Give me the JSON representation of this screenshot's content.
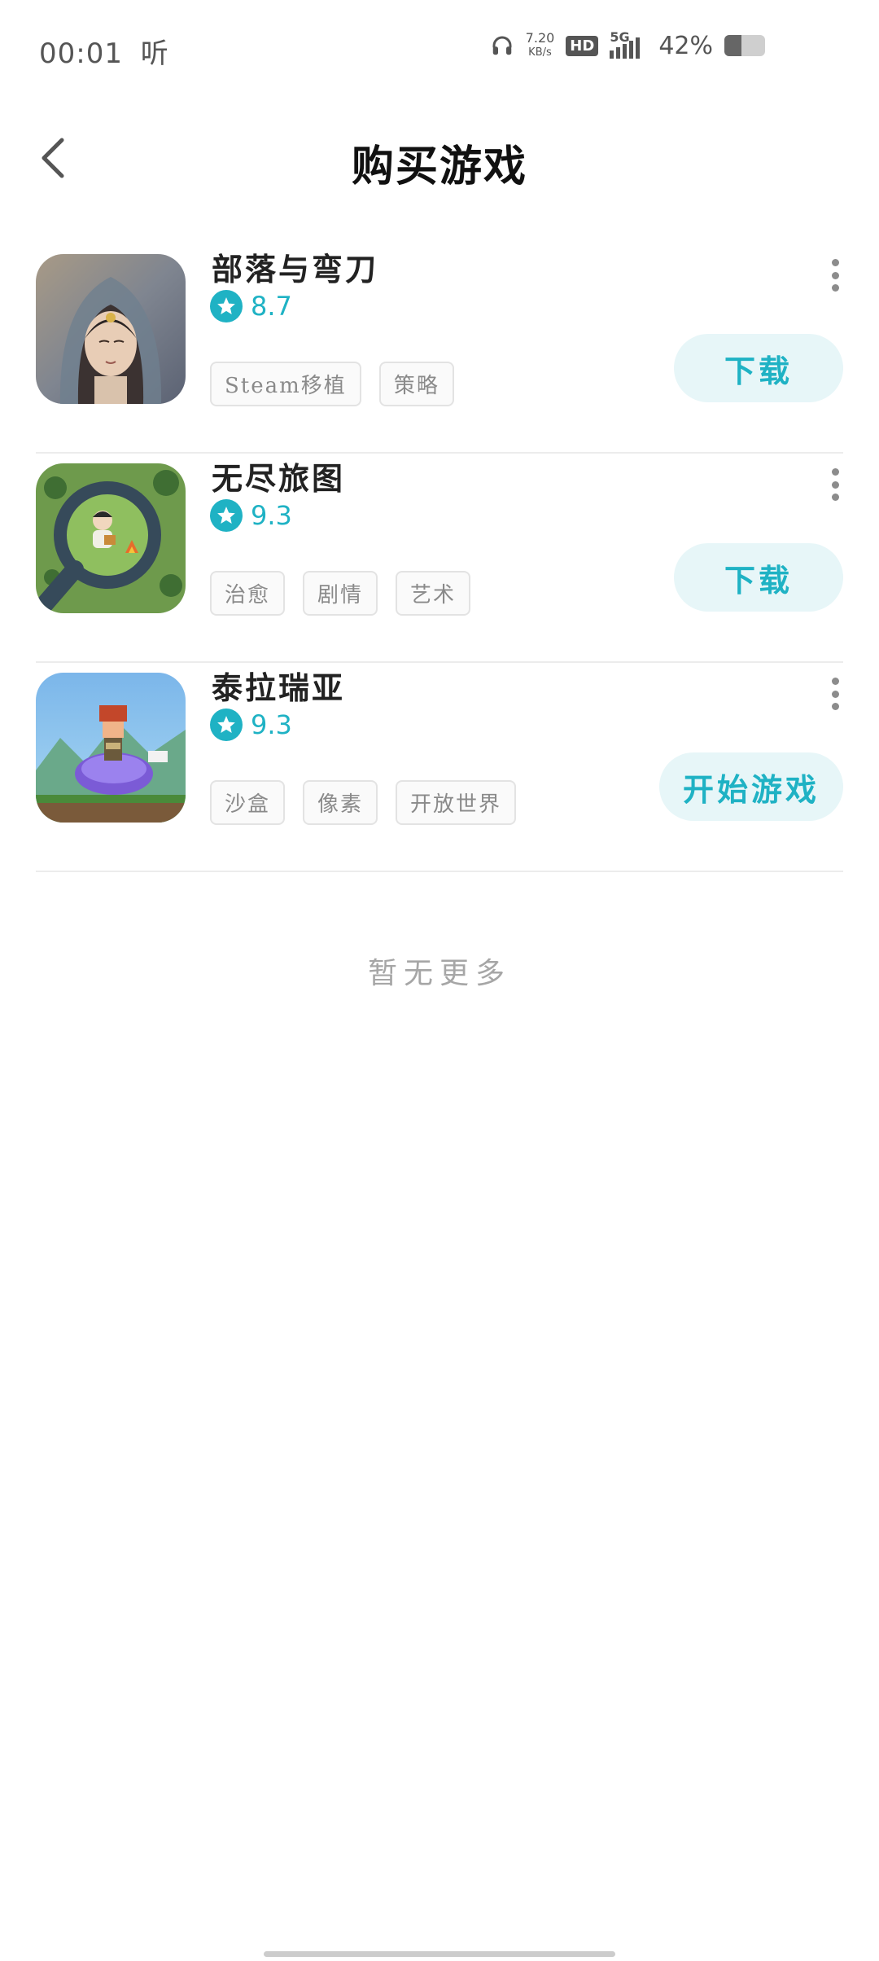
{
  "status_bar": {
    "time": "00:01",
    "extra": "听",
    "net_speed_value": "7.20",
    "net_speed_unit": "KB/s",
    "hd": "HD",
    "network": "5G",
    "battery_pct": "42%",
    "battery_level": 0.42
  },
  "header": {
    "title": "购买游戏",
    "back_icon": "chevron-left-icon"
  },
  "games": [
    {
      "name": "部落与弯刀",
      "rating": "8.7",
      "tags": [
        "Steam移植",
        "策略"
      ],
      "action": "下载"
    },
    {
      "name": "无尽旅图",
      "rating": "9.3",
      "tags": [
        "治愈",
        "剧情",
        "艺术"
      ],
      "action": "下载"
    },
    {
      "name": "泰拉瑞亚",
      "rating": "9.3",
      "tags": [
        "沙盒",
        "像素",
        "开放世界"
      ],
      "action": "开始游戏"
    }
  ],
  "footer": {
    "no_more": "暂无更多"
  },
  "colors": {
    "accent": "#1fb2c4",
    "button_bg": "#e7f6f8",
    "divider": "#ececec"
  }
}
